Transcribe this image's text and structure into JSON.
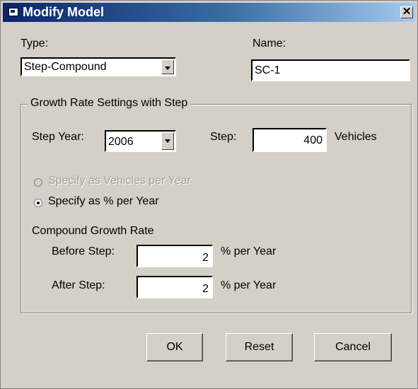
{
  "window": {
    "title": "Modify Model"
  },
  "type": {
    "label": "Type:",
    "value": "Step-Compound"
  },
  "name": {
    "label": "Name:",
    "value": "SC-1"
  },
  "growth": {
    "group_title": "Growth Rate Settings with Step",
    "step_year_label": "Step Year:",
    "step_year_value": "2006",
    "step_label": "Step:",
    "step_value": "400",
    "step_unit": "Vehicles",
    "option_vehicles": "Specify as Vehicles per Year",
    "option_percent": "Specify as % per Year",
    "compound_label": "Compound Growth Rate",
    "before_label": "Before Step:",
    "before_value": "2",
    "after_label": "After Step:",
    "after_value": "2",
    "unit": "% per Year"
  },
  "buttons": {
    "ok": "OK",
    "reset": "Reset",
    "cancel": "Cancel"
  }
}
